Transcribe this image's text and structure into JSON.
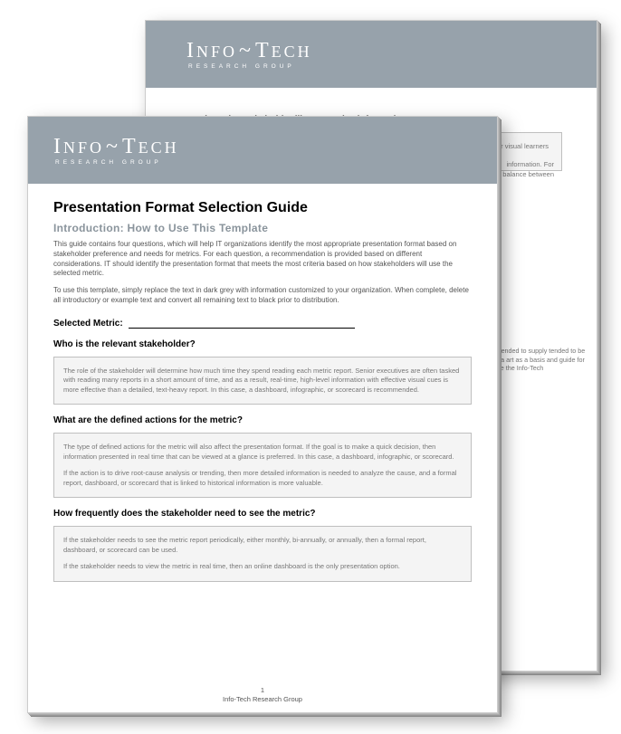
{
  "brand": {
    "main": "Info~Tech",
    "sub": "RESEARCH GROUP"
  },
  "back": {
    "q4": "How does the stakeholder like to receive information?",
    "a4_line1": "Personal preference is a huge factor when deciding on the presentation format for each stakeholder. For visual learners and processors, an infographic will increase the level of engagement. For detail-oriented stakeholders",
    "a4_frag_a": "information. For",
    "a4_frag_b": "ght balance between",
    "disclaimer": "ts are intended to supply tended to be used as a art as a basis and guide for ly replace the Info-Tech"
  },
  "front": {
    "title": "Presentation Format Selection Guide",
    "intro_heading": "Introduction: How to Use This Template",
    "intro_p1": "This guide contains four questions, which will help IT organizations identify the most appropriate presentation format based on stakeholder preference and needs for metrics. For each question, a recommendation is provided based on different considerations. IT should identify the presentation format that meets the most criteria based on how stakeholders will use the selected metric.",
    "intro_p2": "To use this template, simply replace the text in dark grey with information customized to your organization. When complete, delete all introductory or example text and convert all remaining text to black prior to distribution.",
    "selected_metric_label": "Selected Metric:",
    "q1": "Who is the relevant stakeholder?",
    "a1": "The role of the stakeholder will determine how much time they spend reading each metric report. Senior executives are often tasked with reading many reports in a short amount of time, and as a result, real-time, high-level information with effective visual cues is more effective than a detailed, text-heavy report. In this case, a dashboard, infographic, or scorecard is recommended.",
    "q2": "What are the defined actions for the metric?",
    "a2_p1": "The type of defined actions for the metric will also affect the presentation format. If the goal is to make a quick decision, then information presented in real time that can be viewed at a glance is preferred. In this case, a dashboard, infographic, or scorecard.",
    "a2_p2": "If the action is to drive root-cause analysis or trending, then more detailed information is needed to analyze the cause, and a formal report, dashboard, or scorecard that is linked to historical information is more valuable.",
    "q3": "How frequently does the stakeholder need to see the metric?",
    "a3_p1": "If the stakeholder needs to see the metric report periodically, either monthly, bi-annually, or annually, then a formal report, dashboard, or scorecard can be used.",
    "a3_p2": "If the stakeholder needs to view the metric in real time, then an online dashboard is the only presentation option.",
    "page_num": "1",
    "footer_org": "Info-Tech Research Group"
  }
}
